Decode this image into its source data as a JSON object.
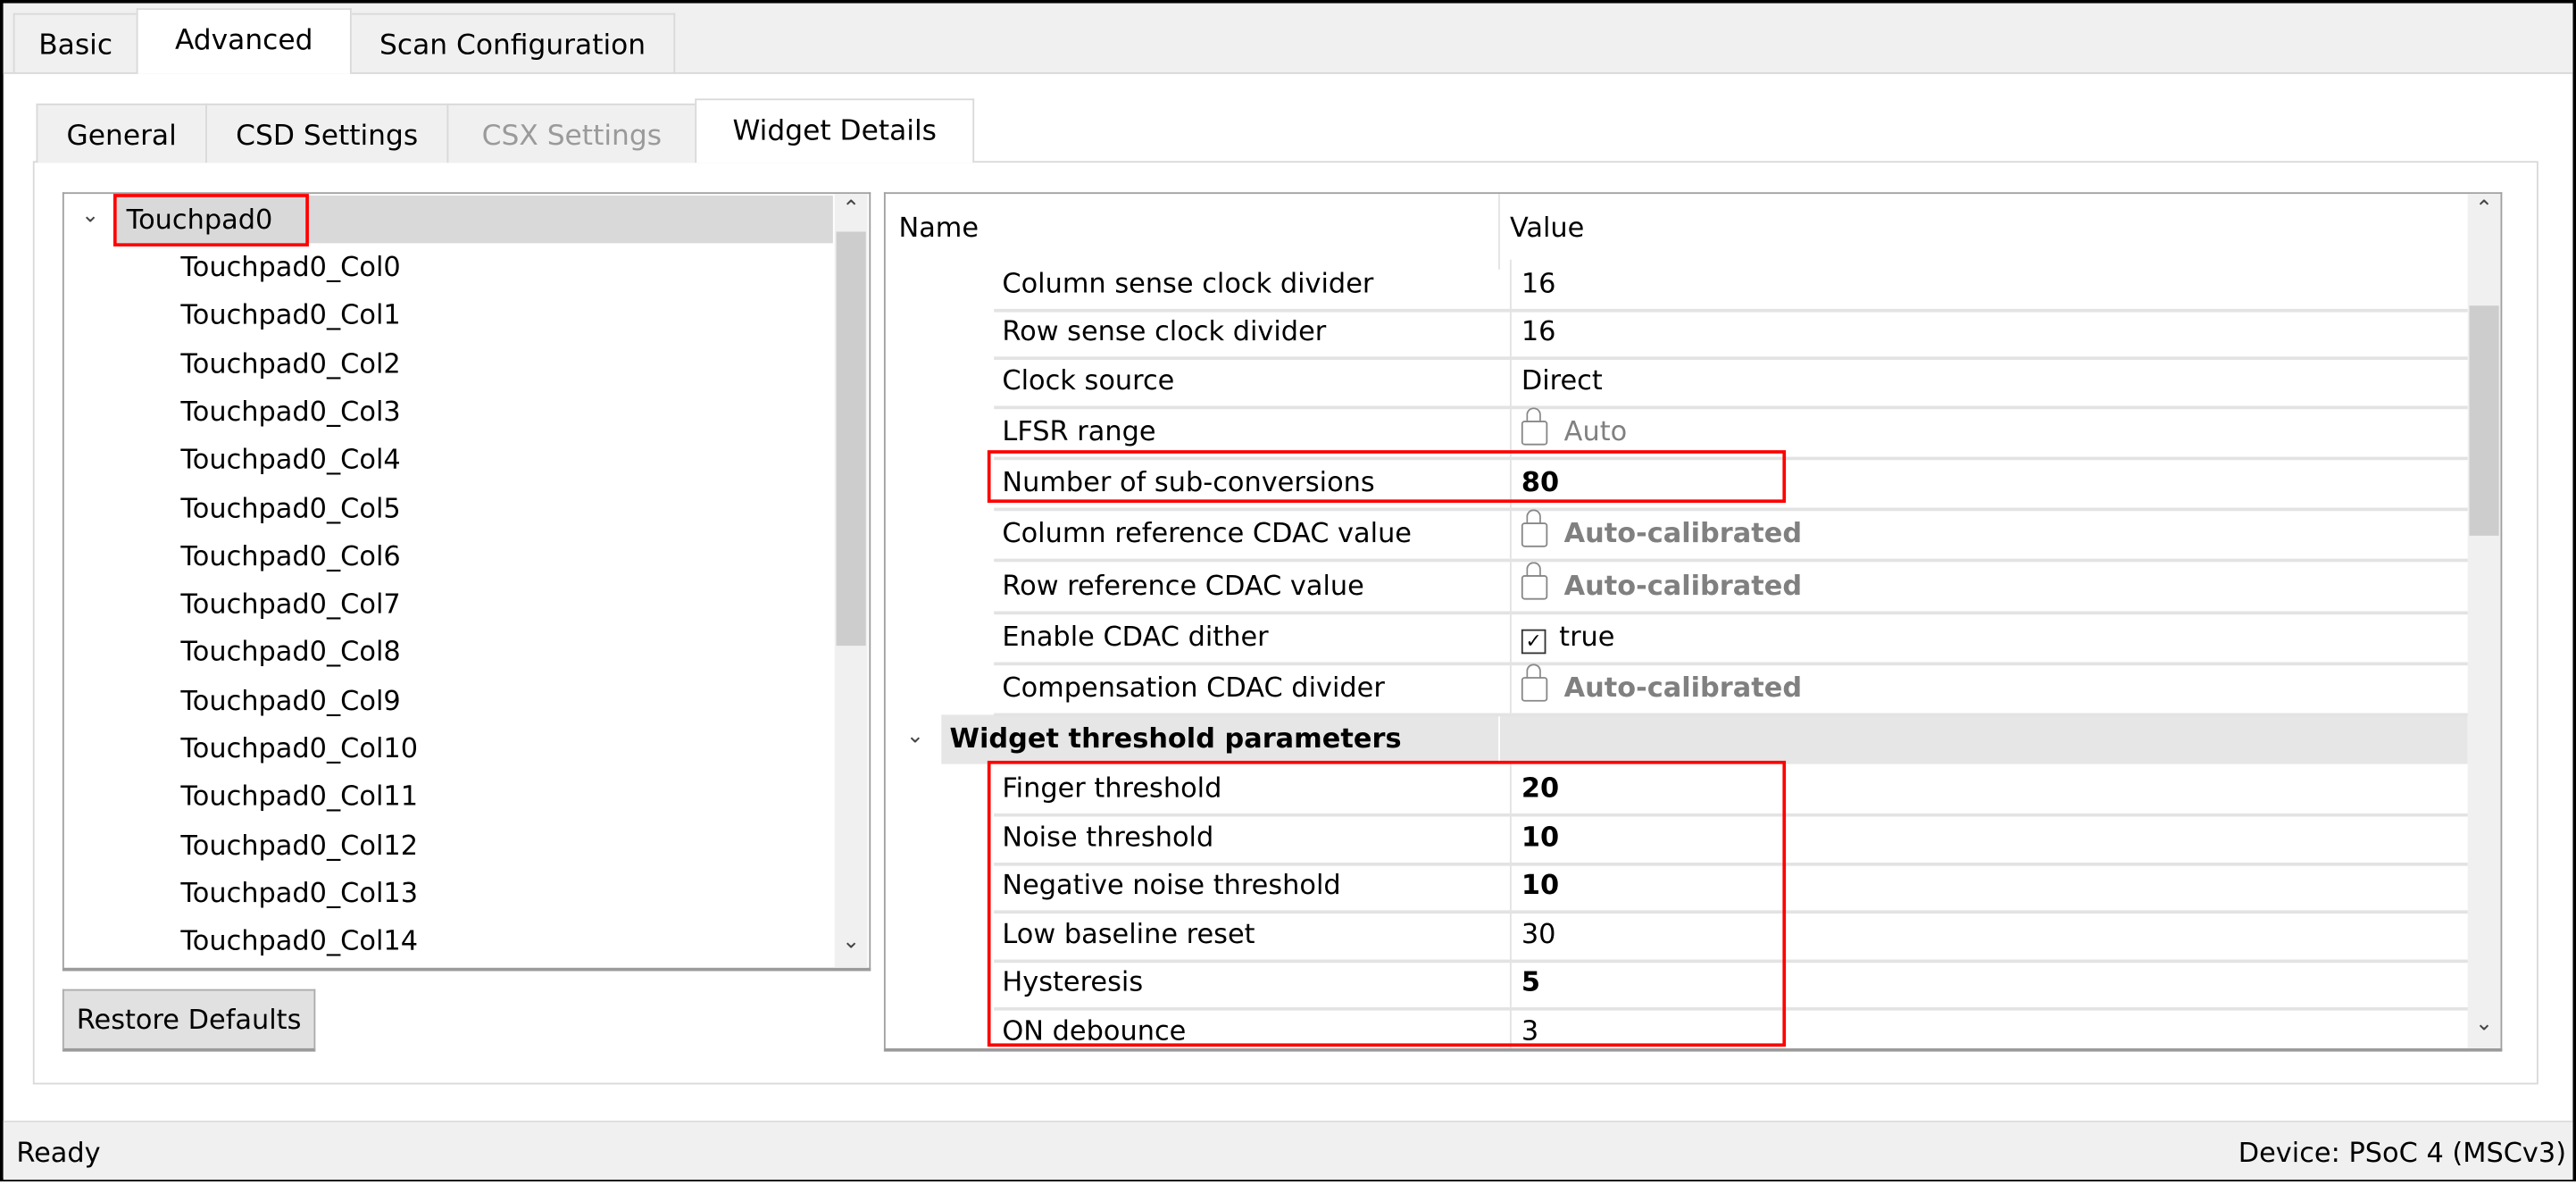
{
  "top_tabs": [
    {
      "label": "Basic"
    },
    {
      "label": "Advanced",
      "selected": true
    },
    {
      "label": "Scan Configuration"
    }
  ],
  "sub_tabs": [
    {
      "label": "General"
    },
    {
      "label": "CSD Settings"
    },
    {
      "label": "CSX Settings",
      "disabled": true
    },
    {
      "label": "Widget Details",
      "selected": true
    }
  ],
  "tree": {
    "root": "Touchpad0",
    "children": [
      "Touchpad0_Col0",
      "Touchpad0_Col1",
      "Touchpad0_Col2",
      "Touchpad0_Col3",
      "Touchpad0_Col4",
      "Touchpad0_Col5",
      "Touchpad0_Col6",
      "Touchpad0_Col7",
      "Touchpad0_Col8",
      "Touchpad0_Col9",
      "Touchpad0_Col10",
      "Touchpad0_Col11",
      "Touchpad0_Col12",
      "Touchpad0_Col13",
      "Touchpad0_Col14"
    ]
  },
  "restore_defaults": "Restore Defaults",
  "grid": {
    "header": {
      "name": "Name",
      "value": "Value"
    },
    "rows": [
      {
        "name": "Column sense clock divider",
        "value": "16"
      },
      {
        "name": "Row sense clock divider",
        "value": "16"
      },
      {
        "name": "Clock source",
        "value": "Direct"
      },
      {
        "name": "LFSR range",
        "value": "Auto",
        "locked": true
      },
      {
        "name": "Number of sub-conversions",
        "value": "80",
        "bold": true
      },
      {
        "name": "Column reference CDAC value",
        "value": "Auto-calibrated",
        "locked": true,
        "bold": true
      },
      {
        "name": "Row reference CDAC value",
        "value": "Auto-calibrated",
        "locked": true,
        "bold": true
      },
      {
        "name": "Enable CDAC dither",
        "value": "true",
        "checkbox": true
      },
      {
        "name": "Compensation CDAC divider",
        "value": "Auto-calibrated",
        "locked": true,
        "bold": true
      }
    ],
    "group": "Widget threshold parameters",
    "group_rows": [
      {
        "name": "Finger threshold",
        "value": "20",
        "bold": true
      },
      {
        "name": "Noise threshold",
        "value": "10",
        "bold": true
      },
      {
        "name": "Negative noise threshold",
        "value": "10",
        "bold": true
      },
      {
        "name": "Low baseline reset",
        "value": "30"
      },
      {
        "name": "Hysteresis",
        "value": "5",
        "bold": true
      },
      {
        "name": "ON debounce",
        "value": "3"
      }
    ]
  },
  "status": {
    "left": "Ready",
    "right": "Device: PSoC 4 (MSCv3)"
  },
  "colors": {
    "highlight": "#ff0000",
    "selected_row": "#d9d9d9"
  }
}
